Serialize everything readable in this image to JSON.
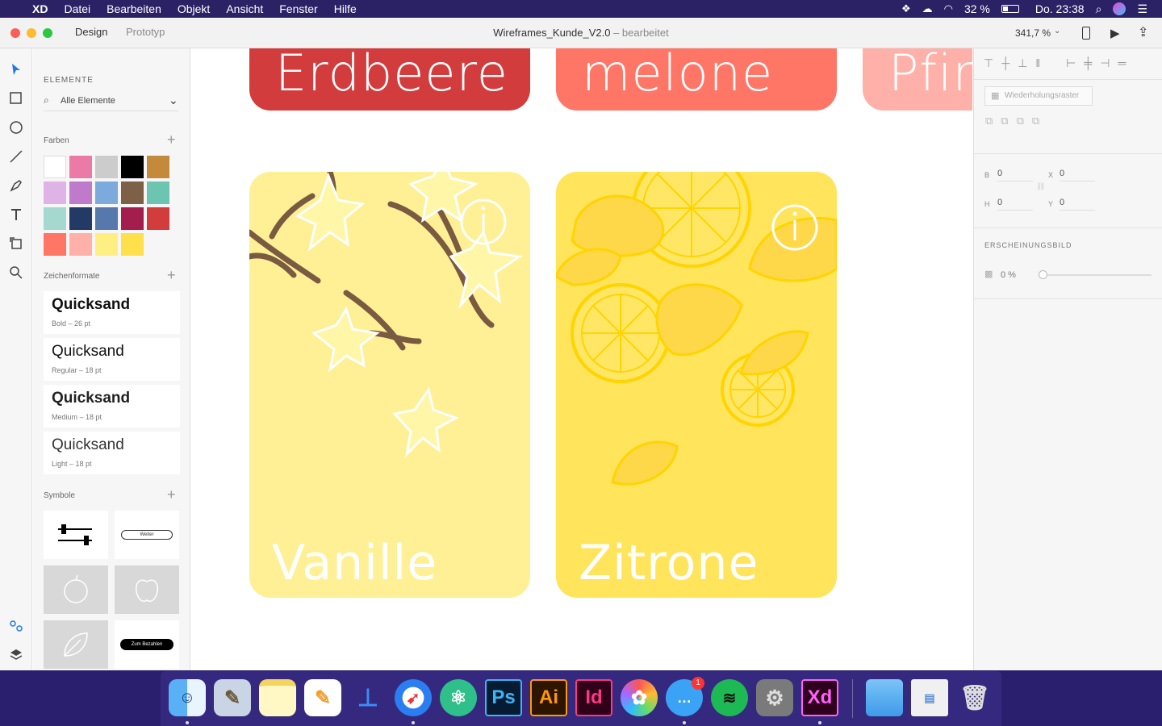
{
  "menubar": {
    "app_name": "XD",
    "items": [
      "Datei",
      "Bearbeiten",
      "Objekt",
      "Ansicht",
      "Fenster",
      "Hilfe"
    ],
    "battery": "32 %",
    "clock": "Do. 23:38"
  },
  "titlebar": {
    "tabs": [
      "Design",
      "Prototyp"
    ],
    "doc_name": "Wireframes_Kunde_V2.0",
    "doc_status": "– bearbeitet",
    "zoom": "341,7 %"
  },
  "assets": {
    "elements_heading": "ELEMENTE",
    "filter_label": "Alle Elemente",
    "colors_heading": "Farben",
    "colors": [
      "#ffffff",
      "#ec7aa6",
      "#cccccc",
      "#000000",
      "#c48a3c",
      "#dfb3e6",
      "#c07acb",
      "#7caadc",
      "#7e6046",
      "#6cc5b0",
      "#a5d8cf",
      "#243a66",
      "#5778ad",
      "#a31d4d",
      "#d23c3c",
      "#ff7566",
      "#ffb0a8",
      "#ffef82",
      "#ffe04a"
    ],
    "charfmt_heading": "Zeichenformate",
    "charfmts": [
      {
        "name": "Quicksand",
        "desc": "Bold – 26 pt"
      },
      {
        "name": "Quicksand",
        "desc": "Regular – 18 pt"
      },
      {
        "name": "Quicksand",
        "desc": "Medium – 18 pt"
      },
      {
        "name": "Quicksand",
        "desc": "Light – 18 pt"
      }
    ],
    "symbols_heading": "Symbole",
    "symbol_btn_weiter": "Weiter",
    "symbol_btn_bezahlen": "Zum Bezahlen"
  },
  "canvas": {
    "top_cards": [
      {
        "label": "Erdbeere",
        "color": "#d23c3c"
      },
      {
        "label": "melone",
        "color": "#ff7566"
      },
      {
        "label": "Pfirs",
        "color": "#ffb0a8"
      }
    ],
    "cards": [
      {
        "label": "Vanille",
        "color": "#fff095"
      },
      {
        "label": "Zitrone",
        "color": "#ffe45c"
      }
    ]
  },
  "inspector": {
    "repeat_grid": "Wiederholungsraster",
    "b_label": "B",
    "b_value": "0",
    "x_label": "X",
    "x_value": "0",
    "h_label": "H",
    "h_value": "0",
    "y_label": "Y",
    "y_value": "0",
    "appearance_heading": "ERSCHEINUNGSBILD",
    "opacity": "0 %"
  },
  "dock": {
    "apps": [
      "Finder",
      "Preview",
      "Notes",
      "Pages",
      "Keynote",
      "Safari",
      "Atom",
      "Ps",
      "Ai",
      "Id",
      "Photos",
      "Messages",
      "Spotify",
      "System Preferences",
      "Xd",
      "Folder",
      "Screenshot",
      "Trash"
    ],
    "messages_badge": "1"
  }
}
